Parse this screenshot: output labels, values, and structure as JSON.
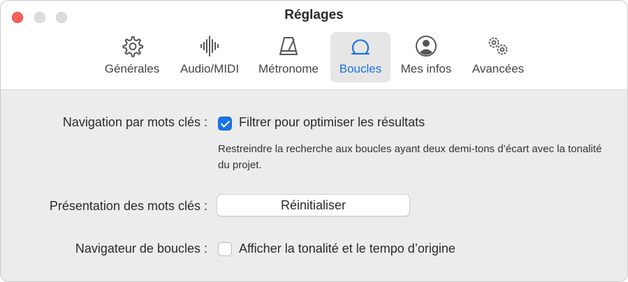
{
  "window": {
    "title": "Réglages"
  },
  "tabs": [
    {
      "label": "Générales",
      "icon": "gear-icon"
    },
    {
      "label": "Audio/MIDI",
      "icon": "waveform-icon"
    },
    {
      "label": "Métronome",
      "icon": "metronome-icon"
    },
    {
      "label": "Boucles",
      "icon": "loop-icon",
      "active": true
    },
    {
      "label": "Mes infos",
      "icon": "person-circle-icon"
    },
    {
      "label": "Avancées",
      "icon": "gears-icon"
    }
  ],
  "keyword_navigation": {
    "label": "Navigation par mots clés :",
    "checkbox_label": "Filtrer pour optimiser les résultats",
    "checked": true,
    "description": "Restreindre la recherche aux boucles ayant deux demi-tons d’écart avec la tonalité du projet."
  },
  "keyword_layout": {
    "label": "Présentation des mots clés :",
    "button_label": "Réinitialiser"
  },
  "loop_browser": {
    "label": "Navigateur de boucles :",
    "checkbox_label": "Afficher la tonalité et le tempo d’origine",
    "checked": false
  },
  "colors": {
    "accent": "#1a73e8",
    "close": "#fe5f57"
  }
}
